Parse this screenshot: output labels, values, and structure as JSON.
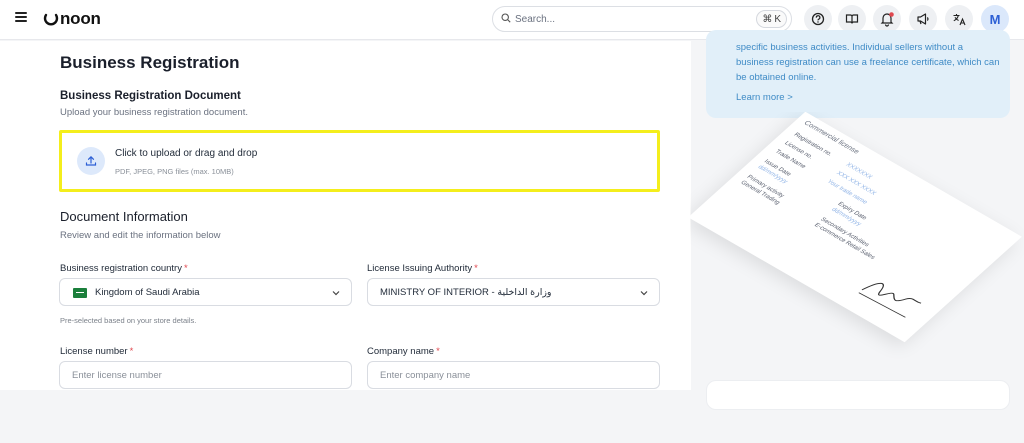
{
  "header": {
    "logo_text": "noon",
    "search": {
      "placeholder": "Search...",
      "shortcut_symbol": "⌘",
      "shortcut_key": "K"
    },
    "icons": [
      "help-icon",
      "book-icon",
      "notifications-icon",
      "megaphone-icon",
      "translate-icon"
    ],
    "avatar_letter": "M",
    "notification_dot_color": "#e0484f"
  },
  "page": {
    "title": "Business Registration",
    "document_section": {
      "title": "Business Registration Document",
      "subtitle": "Upload your business registration document."
    },
    "upload": {
      "main_text": "Click to upload or drag and drop",
      "sub_text": "PDF, JPEG, PNG files (max. 10MB)"
    },
    "info_section": {
      "title": "Document Information",
      "subtitle": "Review and edit the information below"
    },
    "fields": {
      "country": {
        "label": "Business registration country",
        "required_mark": "*",
        "value": "Kingdom of Saudi Arabia",
        "hint": "Pre-selected based on your store details."
      },
      "authority": {
        "label": "License Issuing Authority",
        "required_mark": "*",
        "value": "MINISTRY OF INTERIOR - وزارة الداخلية"
      },
      "license_number": {
        "label": "License number",
        "required_mark": "*",
        "placeholder": "Enter license number",
        "value": ""
      },
      "company_name": {
        "label": "Company name",
        "required_mark": "*",
        "placeholder": "Enter company name",
        "value": ""
      }
    }
  },
  "sidebar": {
    "info_text": "specific business activities. Individual sellers without a business registration can use a freelance certificate, which can be obtained online.",
    "learn_more": "Learn more >"
  },
  "certificate": {
    "heading": "Commercial license",
    "rows": [
      {
        "label": "Registration no.",
        "value": "XXXXXXX"
      },
      {
        "label": "License no.",
        "value": "XXX XXX XXXX"
      },
      {
        "label": "Trade Name",
        "value": "Your trade name"
      },
      {
        "label": "Issue Date",
        "value": "dd/mm/yyyy"
      },
      {
        "label": "Expiry Date",
        "value": "dd/mm/yyyy"
      },
      {
        "label": "Primary activity",
        "value": "General Trading"
      },
      {
        "label": "Secondary Activities",
        "value": "E-commerce   Retail   Sales"
      }
    ]
  },
  "colors": {
    "upload_highlight": "#f4ee1c",
    "accent": "#2c5fd5",
    "info_bg": "#e1eff9",
    "info_text": "#3f8bc6",
    "required": "#e0484f"
  }
}
